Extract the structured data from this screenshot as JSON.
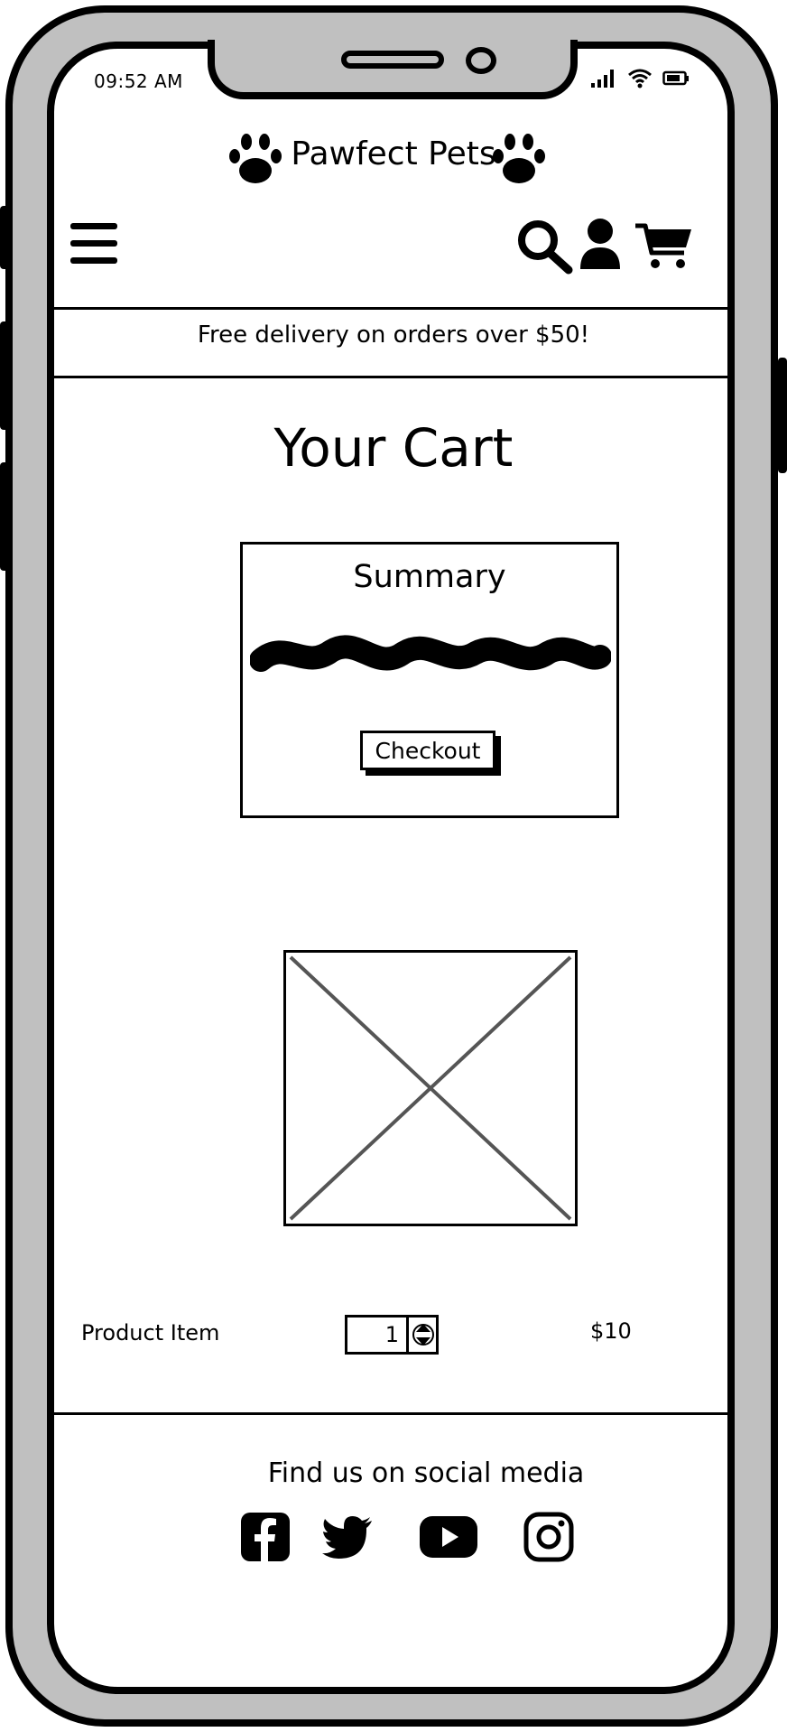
{
  "status_bar": {
    "time": "09:52 AM",
    "icons": [
      "signal-icon",
      "wifi-icon",
      "battery-icon"
    ]
  },
  "header": {
    "brand": "Pawfect Pets",
    "icons": [
      "paw-icon",
      "menu-icon",
      "search-icon",
      "user-icon",
      "cart-icon"
    ]
  },
  "banner": {
    "text": "Free delivery on orders over $50!"
  },
  "cart": {
    "title": "Your Cart",
    "summary": {
      "title": "Summary",
      "checkout_label": "Checkout"
    },
    "item": {
      "name": "Product Item",
      "quantity": "1",
      "price": "$10"
    }
  },
  "footer": {
    "social_title": "Find us on social media",
    "icons": [
      "facebook-icon",
      "twitter-icon",
      "youtube-icon",
      "instagram-icon"
    ]
  },
  "colors": {
    "frame": "#c0c0c0",
    "ink": "#000000",
    "placeholder_line": "#555555"
  }
}
